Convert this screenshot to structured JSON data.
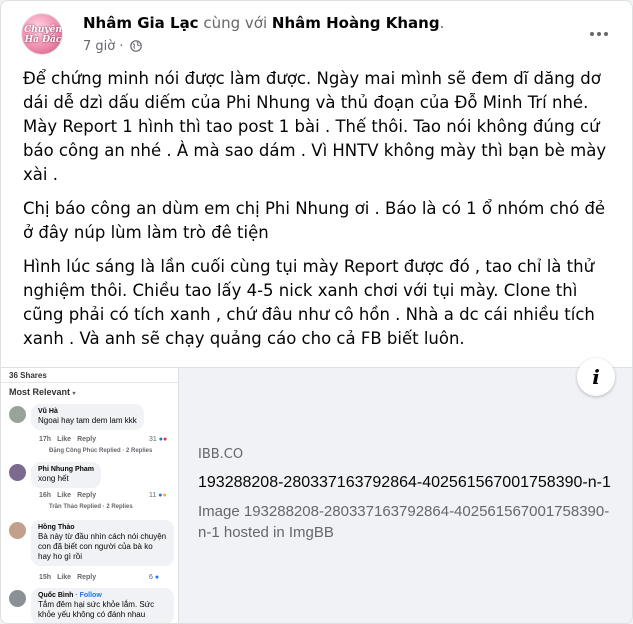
{
  "post": {
    "avatar_logo": "Chuyện\nHà Đắc",
    "author": "Nhâm Gia Lạc",
    "with_text": "cùng với",
    "tagged": "Nhâm Hoàng Khang",
    "tagged_suffix": ".",
    "time": "7 giờ",
    "time_sep": "·",
    "privacy_icon": "globe-icon",
    "more_icon": "more-options-icon",
    "paragraphs": [
      "Để chứng minh nói được làm được. Ngày mai mình sẽ đem dĩ dăng dơ dái dễ dzì dấu diếm của Phi Nhung và thủ đoạn của Đỗ Minh Trí nhé. Mày Report 1 hình thì tao post 1 bài . Thế thôi. Tao nói không đúng cứ báo công an nhé . À mà sao  dám . Vì HNTV không mày thì bạn bè mày xài .",
      "Chị báo công an dùm em chị Phi Nhung ơi . Báo là có 1 ổ nhóm chó đẻ ở đây núp lùm làm trò đê tiện",
      "Hình lúc sáng là lần cuối cùng tụi mày Report được đó , tao chỉ là thử nghiệm thôi. Chiều tao lấy 4-5 nick xanh chơi với tụi mày. Clone thì cũng phải có tích xanh , chứ đâu như cô hồn . Nhà a dc cái nhiều tích xanh . Và anh sẽ chạy quảng cáo cho cả FB biết luôn."
    ]
  },
  "attachment": {
    "info_icon": "info-icon",
    "info_label": "i",
    "domain": "IBB.CO",
    "title": "193288208-280337163792864-402561567001758390-n-1",
    "description": "Image 193288208-280337163792864-402561567001758390-n-1 hosted in ImgBB",
    "thumb": {
      "shares": "36 Shares",
      "sort": "Most Relevant",
      "comments": [
        {
          "name": "Vũ Hà",
          "text": "Ngoai hay tam dem lam kkk",
          "time": "17h",
          "like": "Like",
          "reply": "Reply",
          "reacts": "31",
          "replied": "Đặng Công Phúc Replied · 2 Replies"
        },
        {
          "name": "Phi Nhung Pham",
          "text": "xong hết",
          "time": "16h",
          "like": "Like",
          "reply": "Reply",
          "reacts": "11",
          "replied": "Trần Thảo Replied · 2 Replies"
        },
        {
          "name": "Hồng Thảo",
          "text": "Bà này từ đầu nhìn cách nói chuyện con đã biết con người của bà ko hay ho gì rồi",
          "time": "15h",
          "like": "Like",
          "reply": "Reply",
          "reacts": "6",
          "replied": ""
        },
        {
          "name": "Quốc Bình",
          "follow": "· Follow",
          "text": "Tắm đêm hại sức khỏe lắm. Sức khỏe yếu không có đánh nhau",
          "time": "",
          "like": "",
          "reply": "",
          "reacts": "",
          "replied": ""
        }
      ]
    }
  }
}
